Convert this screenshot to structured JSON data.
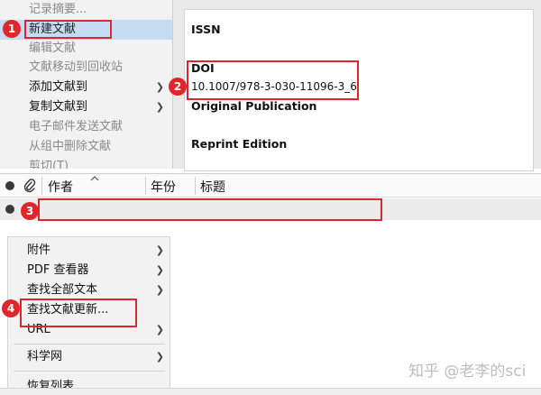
{
  "colors": {
    "annotation_red": "#e0262b",
    "menu_bg": "#f2f2f2",
    "highlight_blue": "#c6dcf2"
  },
  "menu_top": {
    "items": [
      {
        "label": "记录摘要...",
        "state": "disabled",
        "submenu": false
      },
      {
        "label": "新建文献",
        "state": "highlight",
        "submenu": false
      },
      {
        "label": "编辑文献",
        "state": "disabled",
        "submenu": false
      },
      {
        "label": "文献移动到回收站",
        "state": "disabled",
        "submenu": false
      },
      {
        "label": "添加文献到",
        "state": "active",
        "submenu": true
      },
      {
        "label": "复制文献到",
        "state": "active",
        "submenu": true
      },
      {
        "label": "电子邮件发送文献",
        "state": "disabled",
        "submenu": false
      },
      {
        "label": "从组中删除文献",
        "state": "disabled",
        "submenu": false
      },
      {
        "label": "剪切(T)",
        "state": "disabled",
        "submenu": false
      }
    ]
  },
  "reference_panel": {
    "issn_label": "ISSN",
    "doi_label": "DOI",
    "doi_value": "10.1007/978-3-030-11096-3_6",
    "original_publication_label": "Original Publication",
    "reprint_edition_label": "Reprint Edition"
  },
  "item_table": {
    "columns": {
      "author": "作者",
      "year": "年份",
      "title": "标题"
    },
    "attachment_icon": "paperclip-icon",
    "read_status_icon": "circle-icon"
  },
  "menu_bottom": {
    "items": [
      {
        "label": "附件",
        "submenu": true
      },
      {
        "label": "PDF 查看器",
        "submenu": true
      },
      {
        "label": "查找全部文本",
        "submenu": true
      },
      {
        "label": "查找文献更新...",
        "submenu": false
      },
      {
        "label": "URL",
        "submenu": true
      },
      {
        "label": "科学网",
        "submenu": true
      },
      {
        "label": "恢复列表",
        "submenu": false
      }
    ]
  },
  "annotations": {
    "badge_1": "1",
    "badge_2": "2",
    "badge_3": "3",
    "badge_4": "4"
  },
  "watermark": "知乎 @老李的sci"
}
